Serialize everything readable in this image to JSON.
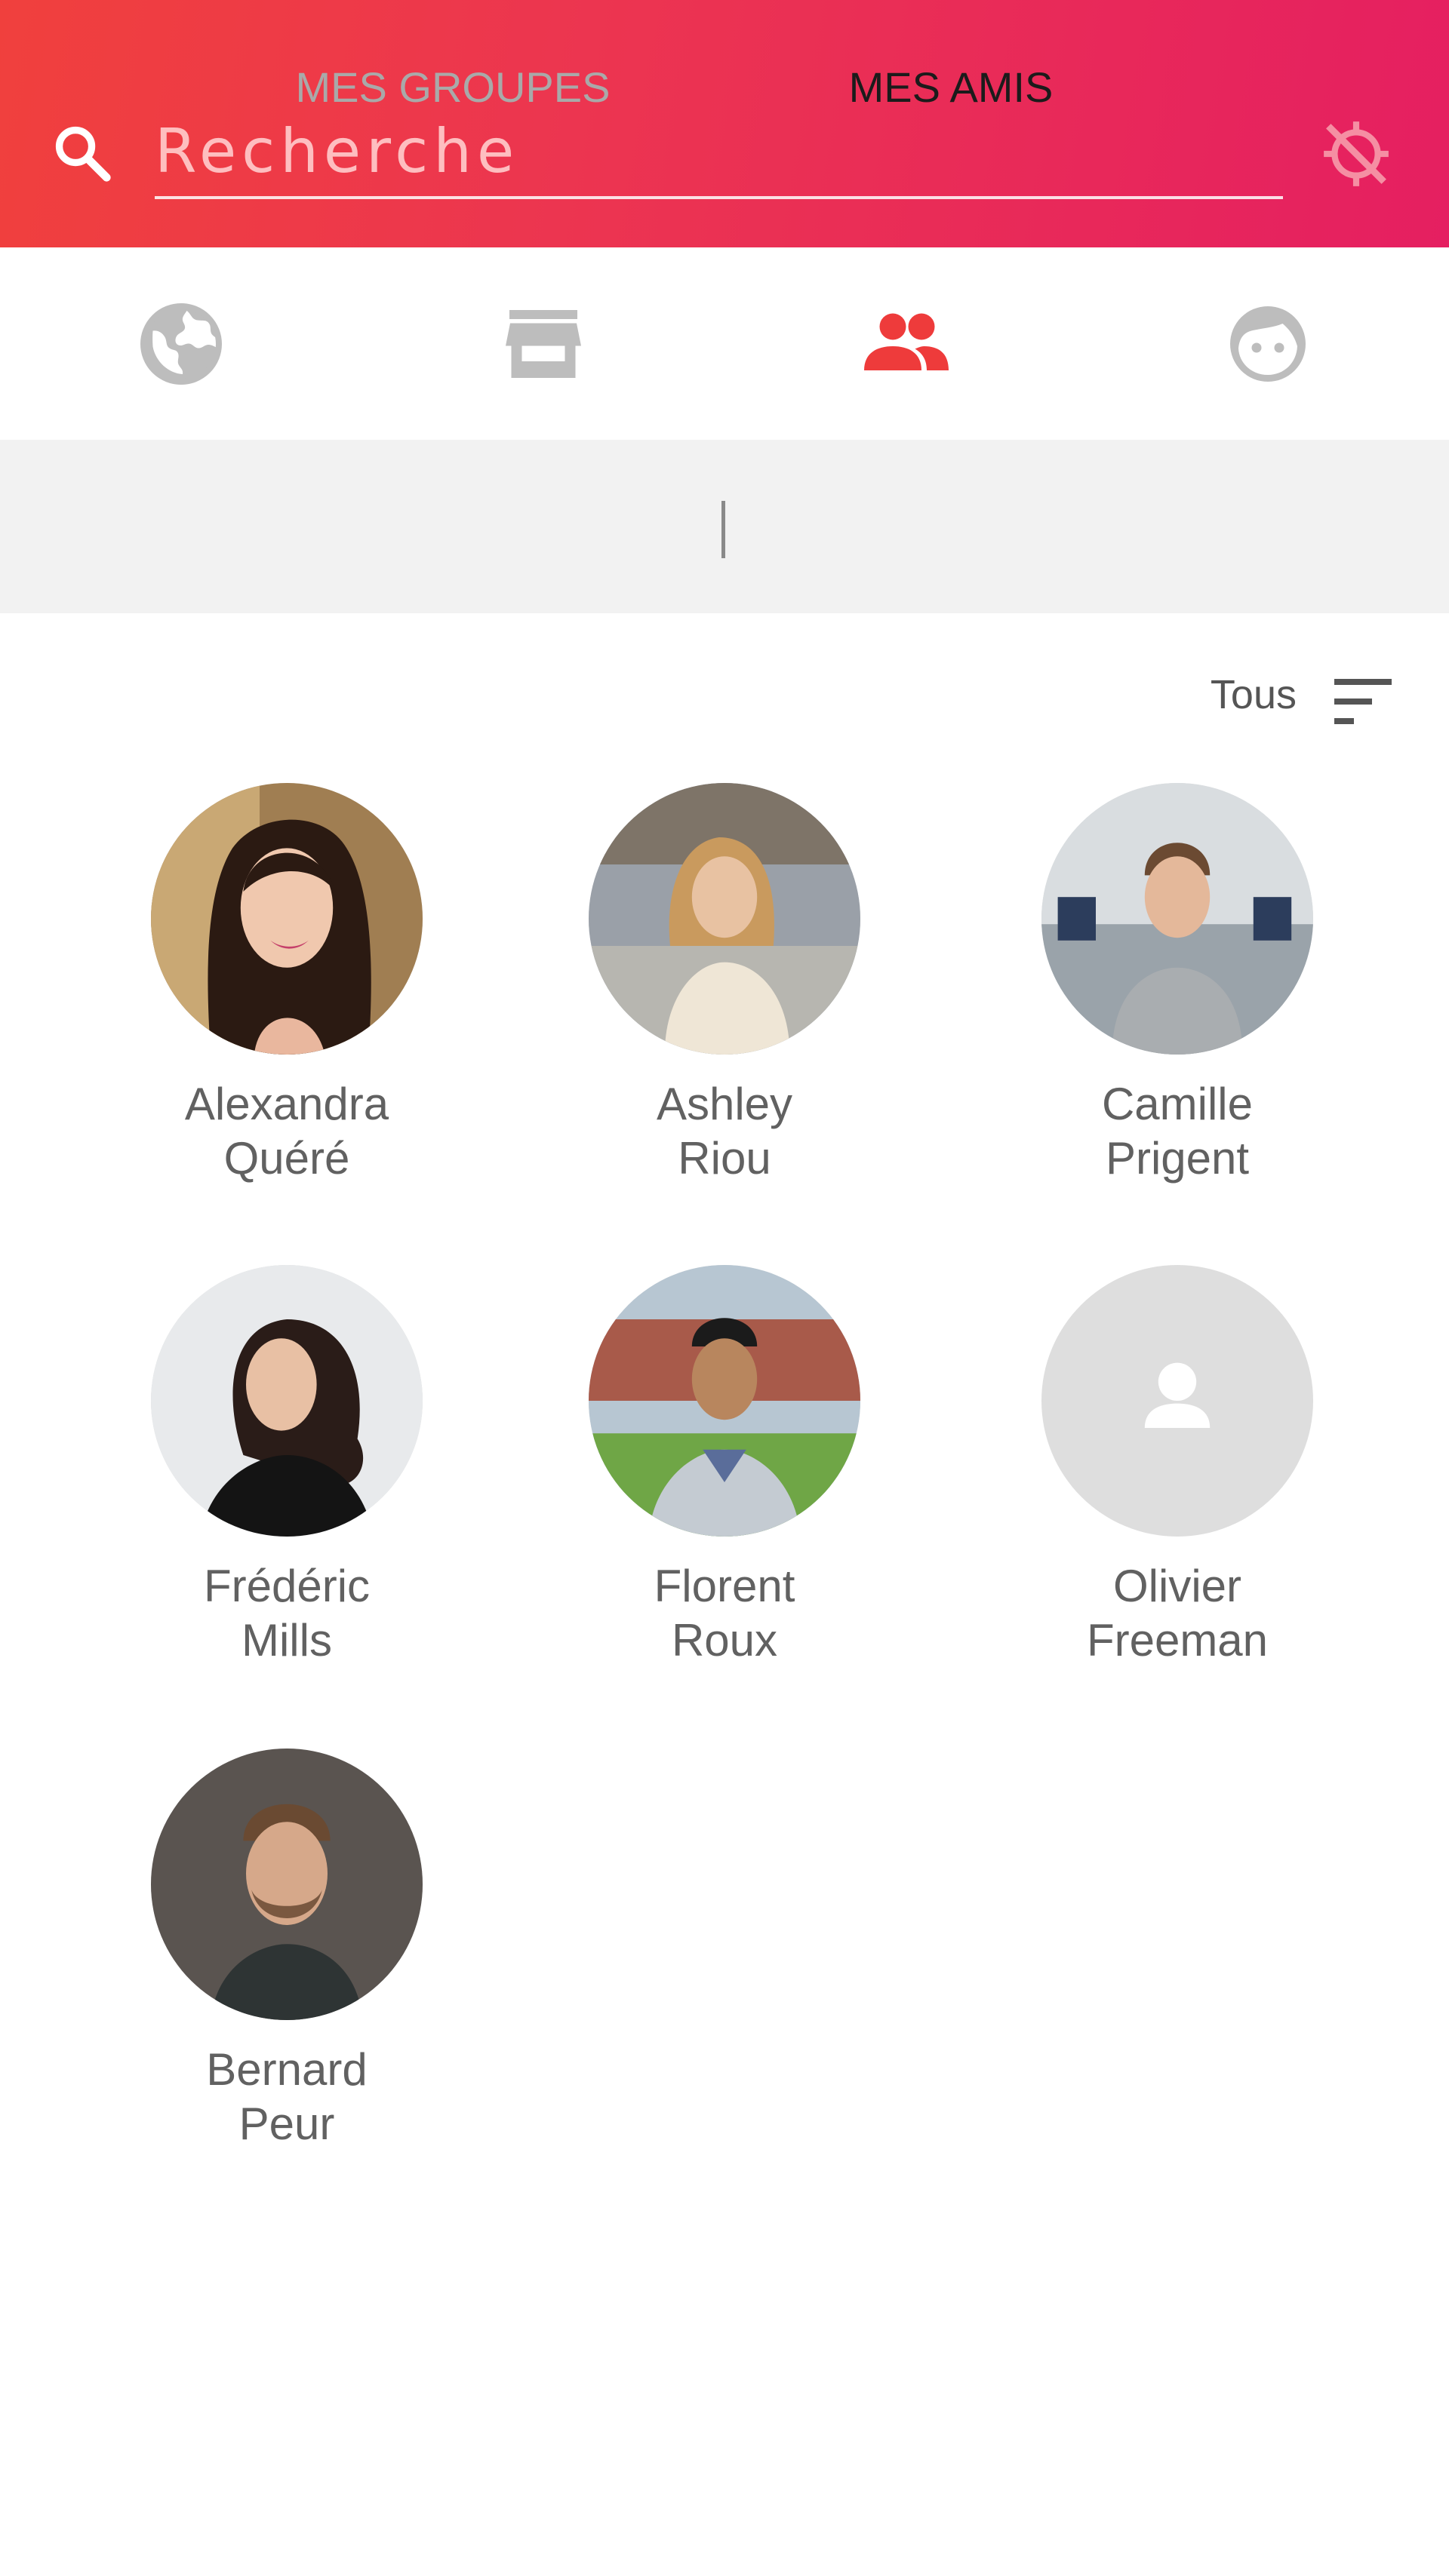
{
  "search": {
    "placeholder": "Recherche",
    "value": ""
  },
  "header": {
    "gradient_colors": [
      "#f0403d",
      "#e51f61"
    ],
    "search_icon": "search-icon",
    "location_icon": "location-off-icon"
  },
  "nav": {
    "active_color": "#ee3b3b",
    "inactive_color": "#bdbdbd",
    "items": [
      {
        "icon": "globe-icon",
        "active": false
      },
      {
        "icon": "store-icon",
        "active": false
      },
      {
        "icon": "people-icon",
        "active": true
      },
      {
        "icon": "face-icon",
        "active": false
      }
    ]
  },
  "segments": {
    "groups_label": "MES GROUPES",
    "friends_label": "MES AMIS",
    "active": "friends"
  },
  "filter": {
    "label": "Tous",
    "icon": "sort-icon"
  },
  "friends": [
    {
      "first": "Alexandra",
      "last": "Quéré",
      "has_photo": true
    },
    {
      "first": "Ashley",
      "last": "Riou",
      "has_photo": true
    },
    {
      "first": "Camille",
      "last": "Prigent",
      "has_photo": true
    },
    {
      "first": "Frédéric",
      "last": "Mills",
      "has_photo": true
    },
    {
      "first": "Florent",
      "last": "Roux",
      "has_photo": true
    },
    {
      "first": "Olivier",
      "last": "Freeman",
      "has_photo": false
    },
    {
      "first": "Bernard",
      "last": "Peur",
      "has_photo": true
    }
  ]
}
